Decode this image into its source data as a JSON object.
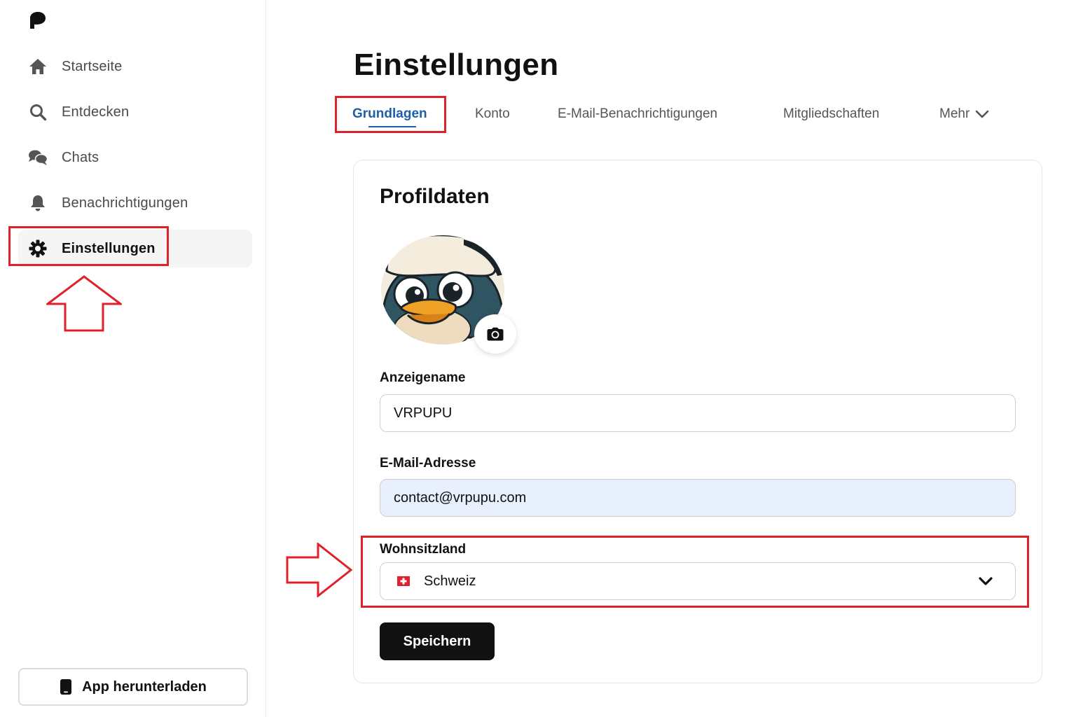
{
  "sidebar": {
    "items": [
      {
        "label": "Startseite",
        "icon": "home-icon"
      },
      {
        "label": "Entdecken",
        "icon": "search-icon"
      },
      {
        "label": "Chats",
        "icon": "chat-bubbles-icon"
      },
      {
        "label": "Benachrichtigungen",
        "icon": "bell-icon"
      },
      {
        "label": "Einstellungen",
        "icon": "gear-icon",
        "active": true
      }
    ],
    "download_label": "App herunterladen"
  },
  "page": {
    "title": "Einstellungen"
  },
  "tabs": [
    {
      "label": "Grundlagen",
      "active": true
    },
    {
      "label": "Konto"
    },
    {
      "label": "E-Mail-Benachrichtigungen"
    },
    {
      "label": "Mitgliedschaften"
    },
    {
      "label": "Mehr"
    }
  ],
  "profile": {
    "title": "Profildaten",
    "display_name_label": "Anzeigename",
    "display_name_value": "VRPUPU",
    "email_label": "E-Mail-Adresse",
    "email_value": "contact@vrpupu.com",
    "country_label": "Wohnsitzland",
    "country_value": "Schweiz",
    "save_label": "Speichern"
  },
  "colors": {
    "accent": "#1d5fa8",
    "annotation": "#e0202a",
    "autofill": "#e8f0fe"
  }
}
